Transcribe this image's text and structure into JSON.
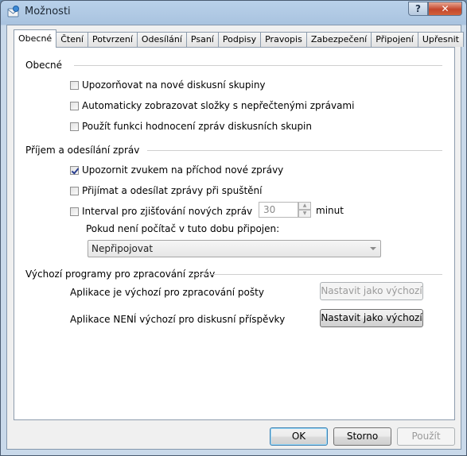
{
  "window": {
    "title": "Možnosti",
    "help_label": "?",
    "close_label": "✕"
  },
  "tabs": [
    {
      "label": "Obecné",
      "active": true
    },
    {
      "label": "Čtení"
    },
    {
      "label": "Potvrzení"
    },
    {
      "label": "Odesílání"
    },
    {
      "label": "Psaní"
    },
    {
      "label": "Podpisy"
    },
    {
      "label": "Pravopis"
    },
    {
      "label": "Zabezpečení"
    },
    {
      "label": "Připojení"
    },
    {
      "label": "Upřesnit"
    }
  ],
  "general": {
    "heading": "Obecné",
    "options": [
      {
        "label": "Upozorňovat na nové diskusní skupiny",
        "checked": false
      },
      {
        "label": "Automaticky zobrazovat složky s nepřečtenými zprávami",
        "checked": false
      },
      {
        "label": "Použít funkci hodnocení zpráv diskusních skupin",
        "checked": false
      }
    ]
  },
  "send_receive": {
    "heading": "Příjem a odesílání zpráv",
    "options": [
      {
        "label": "Upozornit zvukem na příchod nové zprávy",
        "checked": true
      },
      {
        "label": "Přijímat a odesílat zprávy při spuštění",
        "checked": false
      },
      {
        "label": "Interval pro zjišťování nových zpráv",
        "checked": false
      }
    ],
    "interval_value": "30",
    "interval_unit": "minut",
    "offline_label": "Pokud není počítač v tuto dobu připojen:",
    "offline_selected": "Nepřipojovat"
  },
  "defaults": {
    "heading": "Výchozí programy pro zpracování zpráv",
    "mail_text": "Aplikace je výchozí pro zpracování pošty",
    "mail_button": "Nastavit jako výchozí",
    "news_text": "Aplikace NENÍ výchozí pro diskusní příspěvky",
    "news_button": "Nastavit jako výchozí"
  },
  "footer": {
    "ok": "OK",
    "cancel": "Storno",
    "apply": "Použít"
  }
}
